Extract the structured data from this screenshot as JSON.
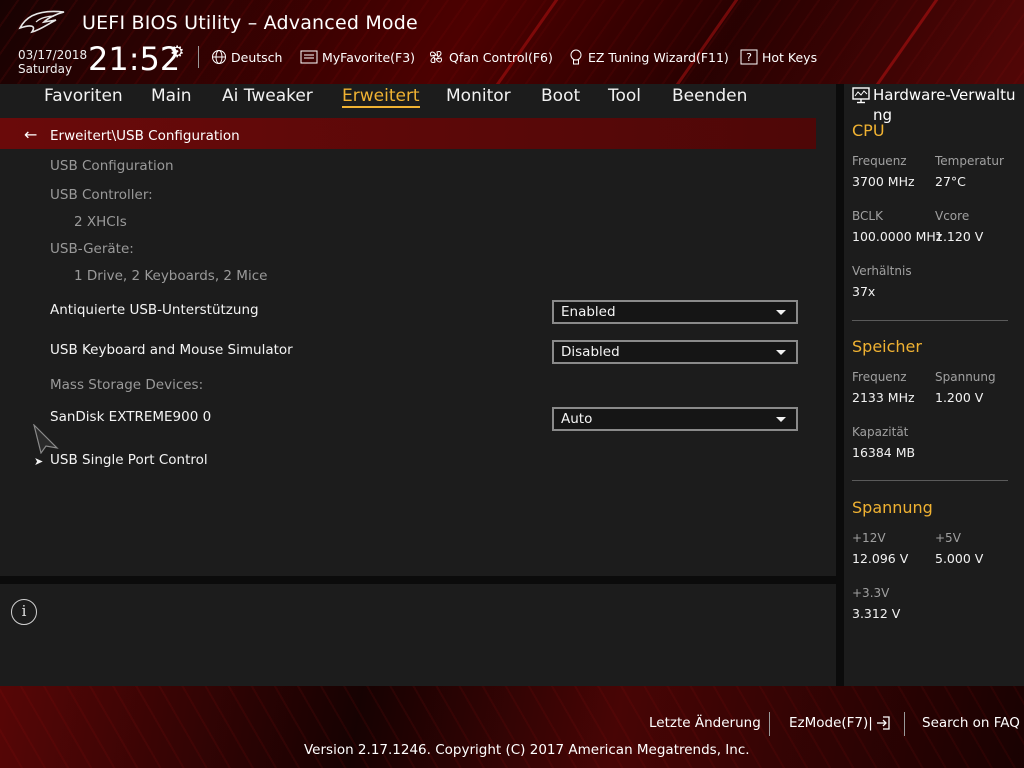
{
  "header": {
    "title": "UEFI BIOS Utility – Advanced Mode",
    "date": "03/17/2018",
    "day": "Saturday",
    "time": "21:52",
    "language": "Deutsch",
    "my_favorite": "MyFavorite(F3)",
    "qfan": "Qfan Control(F6)",
    "ez_tuning": "EZ Tuning Wizard(F11)",
    "hot_keys": "Hot Keys"
  },
  "nav": {
    "tabs": [
      "Favoriten",
      "Main",
      "Ai Tweaker",
      "Erweitert",
      "Monitor",
      "Boot",
      "Tool",
      "Beenden"
    ],
    "active": "Erweitert"
  },
  "main": {
    "breadcrumb": "Erweitert\\USB Configuration",
    "usb_config_heading": "USB Configuration",
    "usb_controller_label": "USB Controller:",
    "usb_controller_value": "2 XHCIs",
    "usb_devices_label": "USB-Geräte:",
    "usb_devices_value": "1 Drive, 2 Keyboards, 2 Mice",
    "legacy_usb_label": "Antiquierte USB-Unterstützung",
    "legacy_usb_value": "Enabled",
    "kbd_mouse_sim_label": "USB Keyboard and Mouse Simulator",
    "kbd_mouse_sim_value": "Disabled",
    "mass_storage_label": "Mass Storage Devices:",
    "sandisk_label": "SanDisk EXTREME900 0",
    "sandisk_value": "Auto",
    "single_port_label": "USB Single Port Control"
  },
  "hw_monitor": {
    "title": "Hardware-Verwaltung",
    "cpu": {
      "heading": "CPU",
      "freq_label": "Frequenz",
      "freq_value": "3700 MHz",
      "temp_label": "Temperatur",
      "temp_value": "27°C",
      "bclk_label": "BCLK",
      "bclk_value": "100.0000 MHz",
      "vcore_label": "Vcore",
      "vcore_value": "1.120 V",
      "ratio_label": "Verhältnis",
      "ratio_value": "37x"
    },
    "memory": {
      "heading": "Speicher",
      "freq_label": "Frequenz",
      "freq_value": "2133 MHz",
      "volt_label": "Spannung",
      "volt_value": "1.200 V",
      "cap_label": "Kapazität",
      "cap_value": "16384 MB"
    },
    "voltage": {
      "heading": "Spannung",
      "v12_label": "+12V",
      "v12_value": "12.096 V",
      "v5_label": "+5V",
      "v5_value": "5.000 V",
      "v33_label": "+3.3V",
      "v33_value": "3.312 V"
    }
  },
  "footer": {
    "last_change": "Letzte Änderung",
    "ez_mode": "EzMode(F7)|",
    "faq": "Search on FAQ",
    "copyright": "Version 2.17.1246. Copyright (C) 2017 American Megatrends, Inc."
  },
  "icons": [
    "rog-logo-icon",
    "gear-icon",
    "globe-icon",
    "favorite-icon",
    "fan-icon",
    "bulb-icon",
    "hotkey-icon",
    "back-arrow-icon",
    "cursor-icon",
    "chevron-right-icon",
    "info-icon",
    "monitor-icon",
    "exit-arrow-icon"
  ],
  "colors": {
    "accent": "#f0b232",
    "breadcrumb_bg": "#6a0a0a",
    "panel_bg": "#1c1c1c"
  }
}
